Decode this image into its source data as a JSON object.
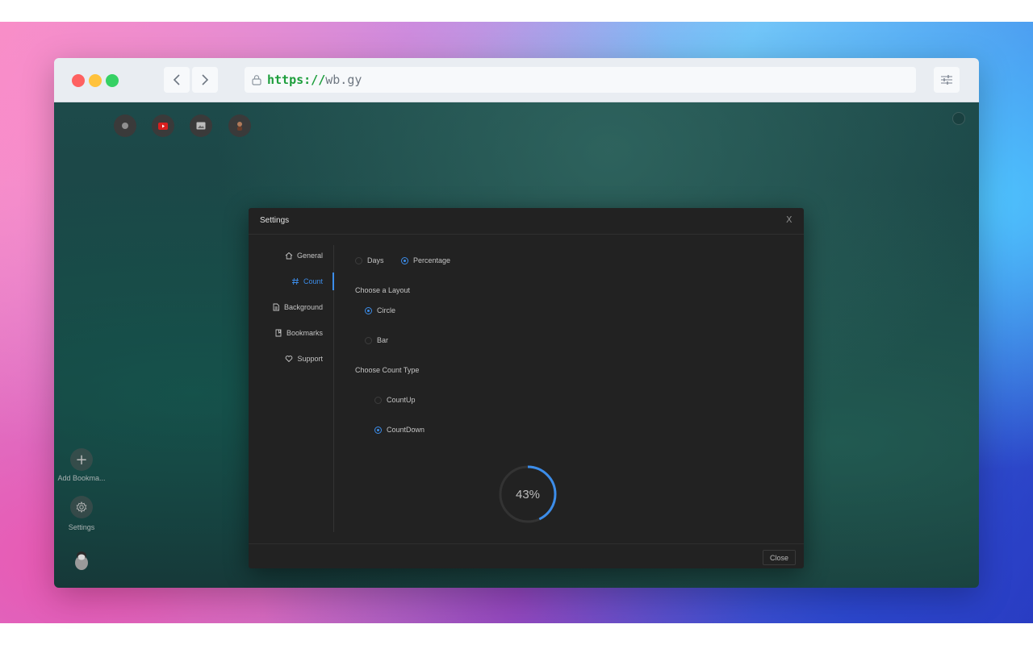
{
  "browser": {
    "url_scheme": "https://",
    "url_host": "wb.gy",
    "back_label": "‹",
    "forward_label": "›"
  },
  "quick_links": [
    {
      "icon": "globe-icon",
      "color": "#9a9a9a"
    },
    {
      "icon": "youtube-icon",
      "color": "#e02020"
    },
    {
      "icon": "image-icon",
      "color": "#c9c9c9"
    },
    {
      "icon": "profile-icon",
      "color": "#b07a5a"
    }
  ],
  "sidebar": {
    "add_label": "Add Bookma...",
    "add_icon": "+",
    "settings_label": "Settings"
  },
  "settings": {
    "title": "Settings",
    "close_x": "X",
    "nav": [
      {
        "label": "General",
        "icon": "home-icon"
      },
      {
        "label": "Count",
        "icon": "hash-icon"
      },
      {
        "label": "Background",
        "icon": "file-icon"
      },
      {
        "label": "Bookmarks",
        "icon": "bookmark-icon"
      },
      {
        "label": "Support",
        "icon": "heart-icon"
      }
    ],
    "display_options": [
      {
        "label": "Days",
        "checked": false
      },
      {
        "label": "Percentage",
        "checked": true
      }
    ],
    "layout_heading": "Choose a Layout",
    "layout_options": [
      {
        "label": "Circle",
        "checked": true
      },
      {
        "label": "Bar",
        "checked": false
      }
    ],
    "count_heading": "Choose Count Type",
    "count_options": [
      {
        "label": "CountUp",
        "checked": false
      },
      {
        "label": "CountDown",
        "checked": true
      }
    ],
    "progress_percent": 43,
    "progress_label": "43%",
    "close_button": "Close",
    "accent_color": "#3c8dea"
  }
}
